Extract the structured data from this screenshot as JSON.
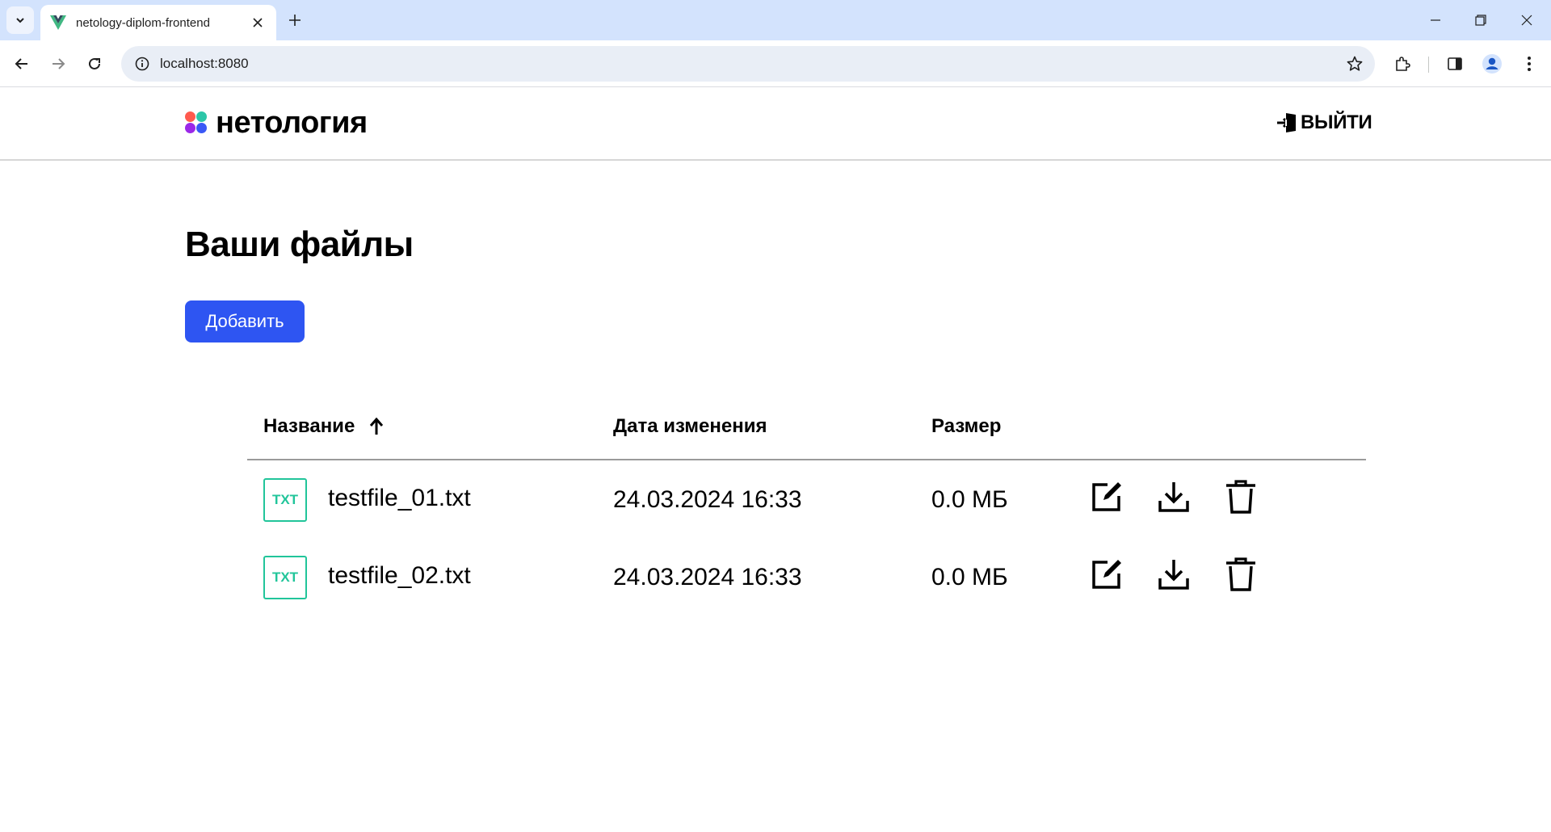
{
  "browser": {
    "tab_title": "netology-diplom-frontend",
    "url": "localhost:8080"
  },
  "header": {
    "logo_text": "нетология",
    "logout_label": "ВЫЙТИ"
  },
  "main": {
    "title": "Ваши файлы",
    "add_button_label": "Добавить",
    "table": {
      "columns": {
        "name": "Название",
        "date": "Дата изменения",
        "size": "Размер"
      },
      "sort": {
        "column": "name",
        "direction": "asc"
      },
      "rows": [
        {
          "type": "TXT",
          "name": "testfile_01.txt",
          "date": "24.03.2024 16:33",
          "size": "0.0 МБ"
        },
        {
          "type": "TXT",
          "name": "testfile_02.txt",
          "date": "24.03.2024 16:33",
          "size": "0.0 МБ"
        }
      ]
    }
  },
  "colors": {
    "accent": "#2e55f2",
    "file_badge": "#21c59a",
    "tabbar": "#d3e3fd"
  },
  "icons": {
    "row_actions": [
      "edit-icon",
      "download-icon",
      "delete-icon"
    ]
  }
}
